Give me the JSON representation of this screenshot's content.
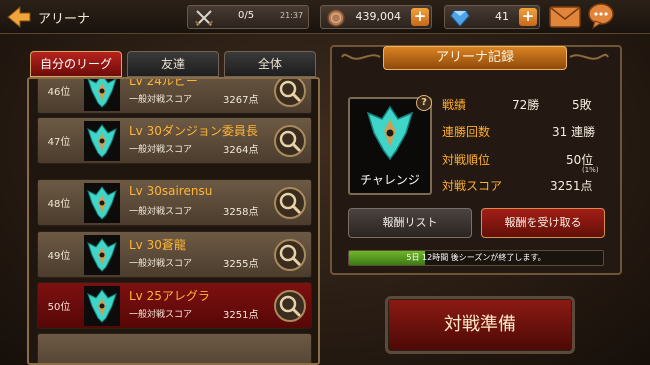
{
  "header": {
    "title": "アリーナ",
    "stamina": "0/5",
    "stamina_timer": "21:37",
    "gold": "439,004",
    "gems": "41",
    "plus_symbol": "+"
  },
  "tabs": [
    {
      "label": "自分のリーグ",
      "active": true
    },
    {
      "label": "友達",
      "active": false
    },
    {
      "label": "全体",
      "active": false
    }
  ],
  "rankings": [
    {
      "rank": "46位",
      "name": "Lv 24ルビー",
      "score_label": "一般対戦スコア",
      "score": "3267点",
      "mine": false
    },
    {
      "rank": "47位",
      "name": "Lv 30ダンジョン委員長",
      "score_label": "一般対戦スコア",
      "score": "3264点",
      "mine": false
    },
    {
      "rank": "48位",
      "name": "Lv 30sairensu",
      "score_label": "一般対戦スコア",
      "score": "3258点",
      "mine": false
    },
    {
      "rank": "49位",
      "name": "Lv 30蒼龍",
      "score_label": "一般対戦スコア",
      "score": "3255点",
      "mine": false
    },
    {
      "rank": "50位",
      "name": "Lv 25アレグラ",
      "score_label": "一般対戦スコア",
      "score": "3251点",
      "mine": true
    }
  ],
  "record": {
    "title": "アリーナ記録",
    "badge_label": "チャレンジ",
    "info_symbol": "?",
    "results_label": "戦績",
    "wins": "72勝",
    "losses": "5敗",
    "streak_label": "連勝回数",
    "streak": "31 連勝",
    "rank_label": "対戦順位",
    "rank": "50位",
    "rank_note": "(1%)",
    "score_label": "対戦スコア",
    "score": "3251点"
  },
  "buttons": {
    "reward_list": "報酬リスト",
    "claim_reward": "報酬を受け取る",
    "prepare_battle": "対戦準備"
  },
  "season": {
    "text": "5日 12時間 後シーズンが終了します。",
    "progress": 0.3
  },
  "colors": {
    "accent_orange": "#ffae2e",
    "active_tab": "#b8221b",
    "progress_green": "#6fb72b",
    "crest_teal": "#3fd6c9"
  }
}
